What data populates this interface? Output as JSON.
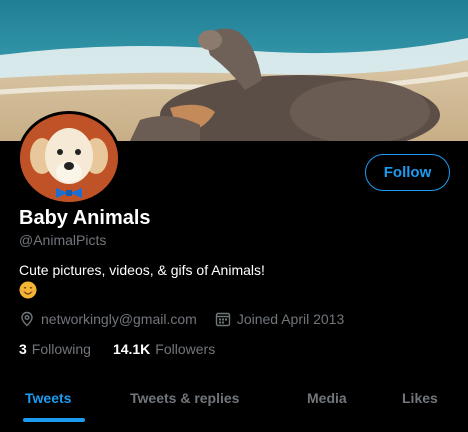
{
  "profile": {
    "display_name": "Baby Animals",
    "handle": "@AnimalPicts",
    "bio": "Cute pictures, videos, & gifs of Animals!",
    "bio_emoji": "smiling-face-emoji",
    "email": "networkingly@gmail.com",
    "joined": "Joined April 2013",
    "banner_image": "baby-elephant-on-beach",
    "avatar_image": "golden-retriever-puppy-with-blue-bowtie"
  },
  "actions": {
    "follow_label": "Follow"
  },
  "stats": {
    "following_count": "3",
    "following_label": "Following",
    "followers_count": "14.1K",
    "followers_label": "Followers"
  },
  "tabs": [
    {
      "label": "Tweets",
      "active": true
    },
    {
      "label": "Tweets & replies",
      "active": false
    },
    {
      "label": "Media",
      "active": false
    },
    {
      "label": "Likes",
      "active": false
    }
  ],
  "colors": {
    "accent": "#1d9bf0",
    "background": "#000000",
    "secondary_text": "#71767b"
  },
  "icons": {
    "location": "location-pin-icon",
    "calendar": "calendar-icon"
  }
}
